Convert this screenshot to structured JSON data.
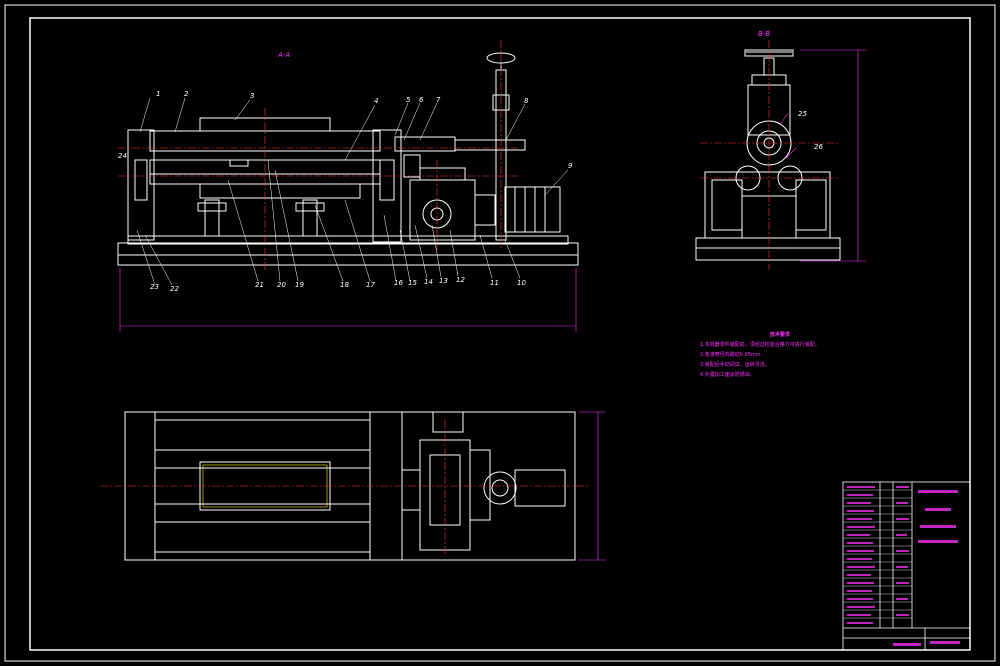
{
  "views": {
    "front_title": "A-A",
    "side_title": "B-B"
  },
  "part_labels": {
    "n1": "1",
    "n2": "2",
    "n3": "3",
    "n4": "4",
    "n5": "5",
    "n6": "6",
    "n7": "7",
    "n8": "8",
    "n9": "9",
    "n10": "10",
    "n11": "11",
    "n12": "12",
    "n13": "13",
    "n14": "14",
    "n15": "15",
    "n16": "16",
    "n17": "17",
    "n18": "18",
    "n19": "19",
    "n20": "20",
    "n21": "21",
    "n22": "22",
    "n23": "23",
    "n24": "24",
    "n25": "25",
    "n26": "26"
  },
  "notes": {
    "title": "技术要求",
    "items": [
      "1.本机器零件装配前，须经过检验合格方可进行装配。",
      "2.各滚筒径向跳动0.05mm",
      "3.装配后手动调试，运转灵活。",
      "4.外露加工面涂防锈油。"
    ]
  },
  "colors": {
    "background": "#000000",
    "outline": "#ffffff",
    "dimension": "#ff33ff",
    "centerline": "#ff3333",
    "accent": "#00ffff"
  }
}
